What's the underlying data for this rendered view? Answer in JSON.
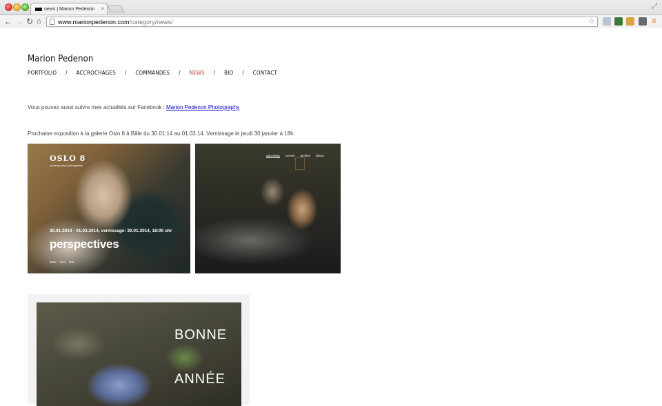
{
  "browser": {
    "tab_title": "news | Marion Pedenon",
    "tab_close": "×",
    "url_host": "www.marionpedenon.com",
    "url_path": "/category/news/"
  },
  "site": {
    "title": "Marion Pedenon",
    "nav": [
      {
        "label": "PORTFOLIO",
        "active": false
      },
      {
        "label": "ACCROCHAGES",
        "active": false
      },
      {
        "label": "COMMANDES",
        "active": false
      },
      {
        "label": "NEWS",
        "active": true
      },
      {
        "label": "BIO",
        "active": false
      },
      {
        "label": "CONTACT",
        "active": false
      }
    ],
    "nav_separator": "/",
    "accent_color": "#c0392b"
  },
  "content": {
    "facebook_text": "Vous pouvez aussi suivre mes actualités sur Facebook : ",
    "facebook_link": "Marion Pedenon Photography",
    "exhibition_text": "Prochaine exposition à la galerie Oslo 8 à Bâle du 30.01.14 au 01.03.14. Vernissage le jeudi 30 janvier à 18h."
  },
  "poster1": {
    "logo": "OSLO 8",
    "logo_sub": "contemporary photography",
    "dates": "30.01.2014 - 01.03.2014, vernissage: 30.01.2014, 18:00 uhr",
    "headline": "perspectives",
    "nav": [
      "back",
      "next",
      "text"
    ]
  },
  "poster2": {
    "nav": [
      "upcoming",
      "current",
      "archive",
      "about"
    ]
  },
  "card": {
    "word1": "BONNE",
    "word2": "ANNÉE"
  }
}
